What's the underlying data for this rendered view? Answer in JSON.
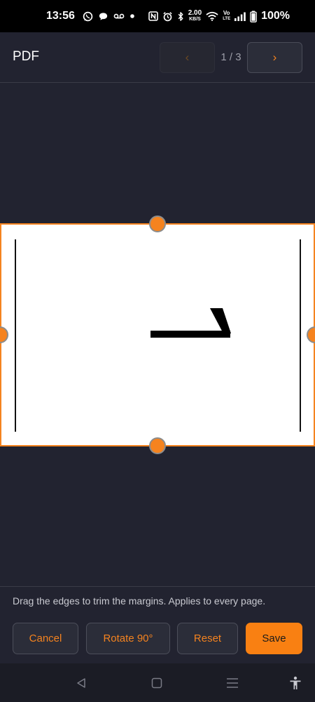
{
  "status_bar": {
    "time": "13:56",
    "network_speed_value": "2.00",
    "network_speed_unit": "KB/S",
    "volte_top": "Vo",
    "volte_bottom": "LTE",
    "battery": "100%",
    "icons": [
      "whatsapp-icon",
      "chat-icon",
      "voicemail-icon",
      "dot-icon",
      "nfc-icon",
      "alarm-icon",
      "bluetooth-icon",
      "wifi-icon",
      "signal-icon",
      "battery-icon"
    ]
  },
  "header": {
    "title": "PDF",
    "prev_label": "‹",
    "next_label": "›",
    "page_indicator": "1 / 3"
  },
  "editor": {
    "hint": "Drag the edges to trim the margins. Applies to every page.",
    "page_glyph": "rotated-page-numeral"
  },
  "actions": {
    "cancel": "Cancel",
    "rotate": "Rotate 90°",
    "reset": "Reset",
    "save": "Save"
  },
  "system_nav": {
    "buttons": [
      "back-icon",
      "home-icon",
      "recents-icon",
      "accessibility-icon"
    ]
  },
  "colors": {
    "accent": "#f5831f",
    "background": "#222330",
    "button_bg": "#2b2d39",
    "save_bg": "#f98012"
  }
}
